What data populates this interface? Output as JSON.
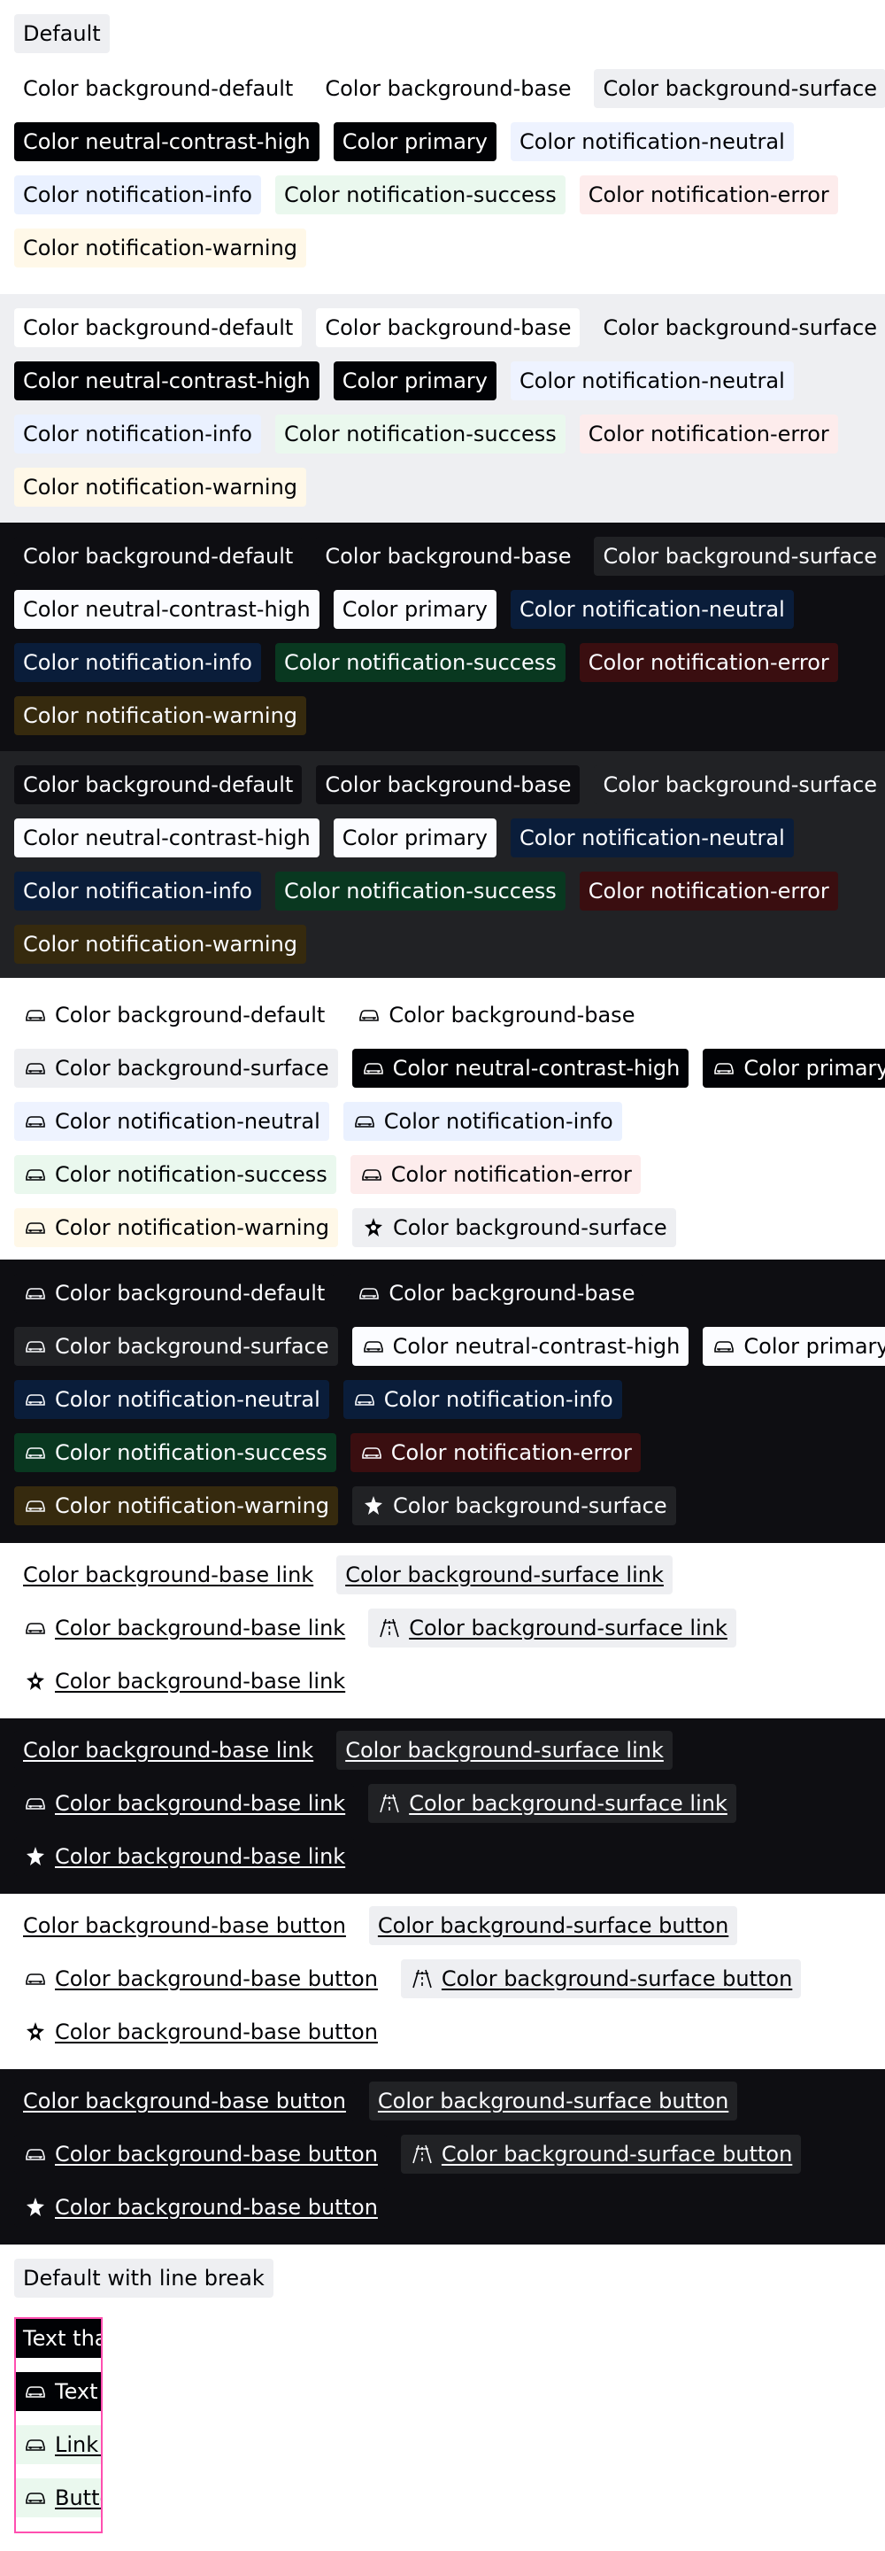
{
  "labels": {
    "default": "Default",
    "default_line_break": "Default with line break"
  },
  "colors": {
    "light_bg": "#ffffff",
    "light_surface_bg": "#eeeff2",
    "dark_bg": "#0e0e12",
    "dark_surface_bg": "#212225",
    "outline_pink": "#ff4fb0"
  },
  "text": {
    "bg_default": "Color background-default",
    "bg_base": "Color background-base",
    "bg_surface": "Color background-surface",
    "contrast_high": "Color neutral-contrast-high",
    "primary": "Color primary",
    "n_neutral": "Color notification-neutral",
    "n_info": "Color notification-info",
    "n_success": "Color notification-success",
    "n_error": "Color notification-error",
    "n_warning": "Color notification-warning",
    "base_link": "Color background-base link",
    "surface_link": "Color background-surface link",
    "base_button": "Color background-base button",
    "surface_button": "Color background-surface button",
    "break_text": "Text that",
    "break_text_icon": "Text w",
    "break_link": "Link w",
    "break_button": "Butto"
  },
  "icons": {
    "car": "car-icon",
    "highway": "highway-icon",
    "sparkle": "sparkle-icon"
  }
}
